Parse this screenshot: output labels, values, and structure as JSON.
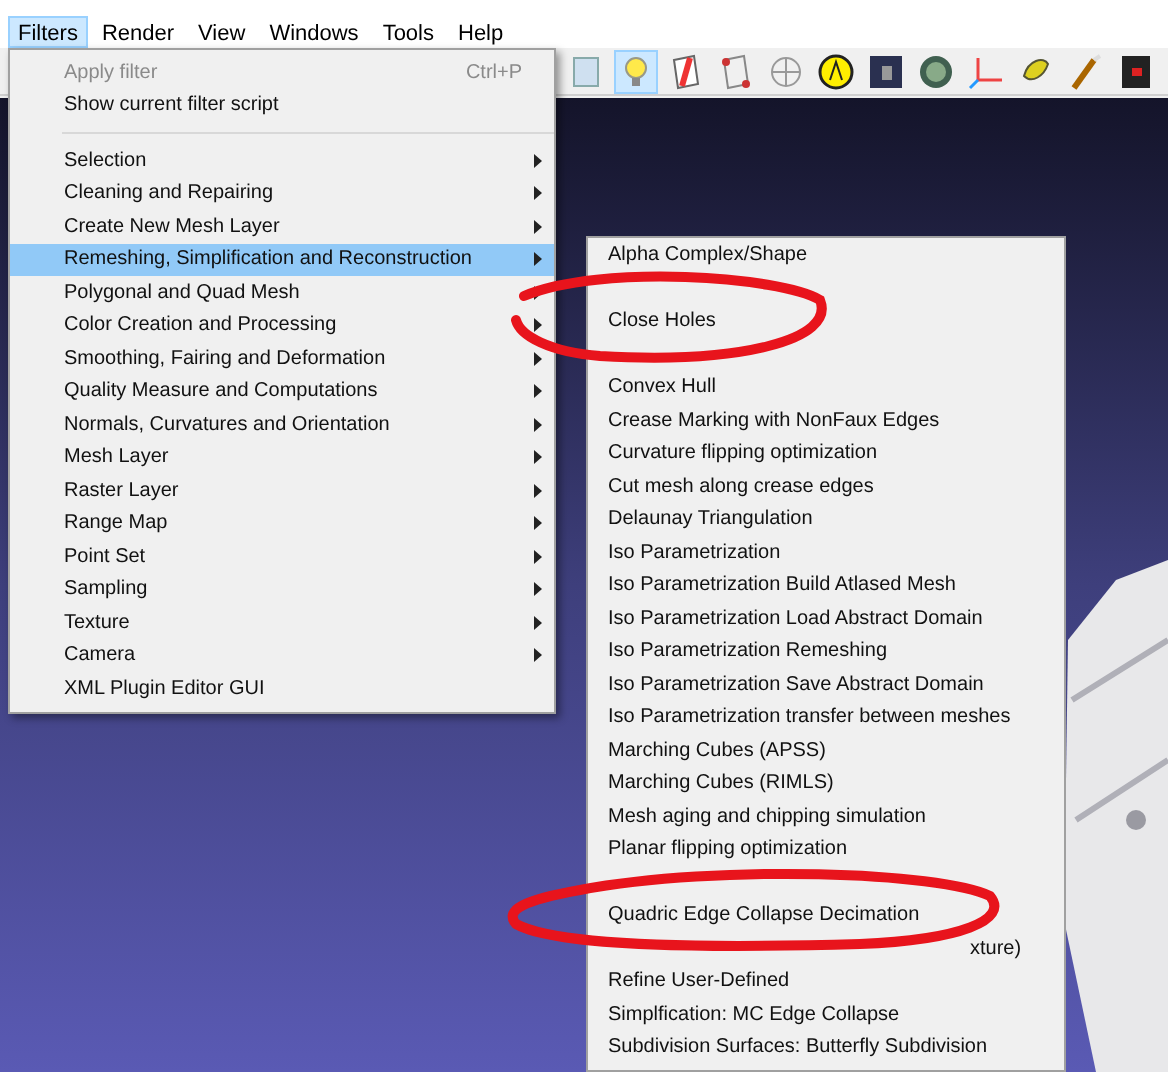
{
  "menu_bar": [
    {
      "label": "Filters",
      "selected": true
    },
    {
      "label": "Render",
      "selected": false
    },
    {
      "label": "View",
      "selected": false
    },
    {
      "label": "Windows",
      "selected": false
    },
    {
      "label": "Tools",
      "selected": false
    },
    {
      "label": "Help",
      "selected": false
    }
  ],
  "toolbar_buttons": [
    {
      "on": false
    },
    {
      "on": true
    },
    {
      "on": false
    },
    {
      "on": false
    },
    {
      "on": false
    },
    {
      "on": false
    },
    {
      "on": false
    },
    {
      "on": false
    },
    {
      "on": false
    },
    {
      "on": false
    },
    {
      "on": false
    },
    {
      "on": false
    }
  ],
  "filters_menu": [
    {
      "label": "Apply filter",
      "shortcut": "Ctrl+P",
      "disabled": true,
      "submenu": false,
      "selected": false
    },
    {
      "label": "Show current filter script",
      "disabled": false,
      "submenu": false,
      "selected": false
    },
    {
      "kind": "separator"
    },
    {
      "label": "Selection",
      "disabled": false,
      "submenu": true,
      "selected": false
    },
    {
      "label": "Cleaning and Repairing",
      "disabled": false,
      "submenu": true,
      "selected": false
    },
    {
      "label": "Create New Mesh Layer",
      "disabled": false,
      "submenu": true,
      "selected": false
    },
    {
      "label": "Remeshing, Simplification and Reconstruction",
      "disabled": false,
      "submenu": true,
      "selected": true
    },
    {
      "label": "Polygonal and Quad Mesh",
      "disabled": false,
      "submenu": true,
      "selected": false
    },
    {
      "label": "Color Creation and Processing",
      "disabled": false,
      "submenu": true,
      "selected": false
    },
    {
      "label": "Smoothing, Fairing and Deformation",
      "disabled": false,
      "submenu": true,
      "selected": false
    },
    {
      "label": "Quality Measure and Computations",
      "disabled": false,
      "submenu": true,
      "selected": false
    },
    {
      "label": "Normals, Curvatures and Orientation",
      "disabled": false,
      "submenu": true,
      "selected": false
    },
    {
      "label": "Mesh Layer",
      "disabled": false,
      "submenu": true,
      "selected": false
    },
    {
      "label": "Raster Layer",
      "disabled": false,
      "submenu": true,
      "selected": false
    },
    {
      "label": "Range Map",
      "disabled": false,
      "submenu": true,
      "selected": false
    },
    {
      "label": "Point Set",
      "disabled": false,
      "submenu": true,
      "selected": false
    },
    {
      "label": "Sampling",
      "disabled": false,
      "submenu": true,
      "selected": false
    },
    {
      "label": "Texture",
      "disabled": false,
      "submenu": true,
      "selected": false
    },
    {
      "label": "Camera",
      "disabled": false,
      "submenu": true,
      "selected": false
    },
    {
      "label": "XML Plugin Editor GUI",
      "disabled": false,
      "submenu": false,
      "selected": false
    }
  ],
  "submenu": [
    "Alpha Complex/Shape",
    {
      "kind": "covered"
    },
    "Close Holes",
    {
      "kind": "covered"
    },
    "Convex Hull",
    "Crease Marking with NonFaux Edges",
    "Curvature flipping optimization",
    "Cut mesh along crease edges",
    "Delaunay Triangulation",
    "Iso Parametrization",
    "Iso Parametrization Build Atlased Mesh",
    "Iso Parametrization Load Abstract Domain",
    "Iso Parametrization Remeshing",
    "Iso Parametrization Save Abstract Domain",
    "Iso Parametrization transfer between meshes",
    "Marching Cubes (APSS)",
    "Marching Cubes (RIMLS)",
    "Mesh aging and chipping simulation",
    "Planar flipping optimization",
    {
      "kind": "covered"
    },
    "Quadric Edge Collapse Decimation",
    {
      "kind": "covered",
      "tail": "xture)"
    },
    "Refine User-Defined",
    "Simplfication: MC Edge Collapse",
    "Subdivision Surfaces: Butterfly Subdivision"
  ]
}
